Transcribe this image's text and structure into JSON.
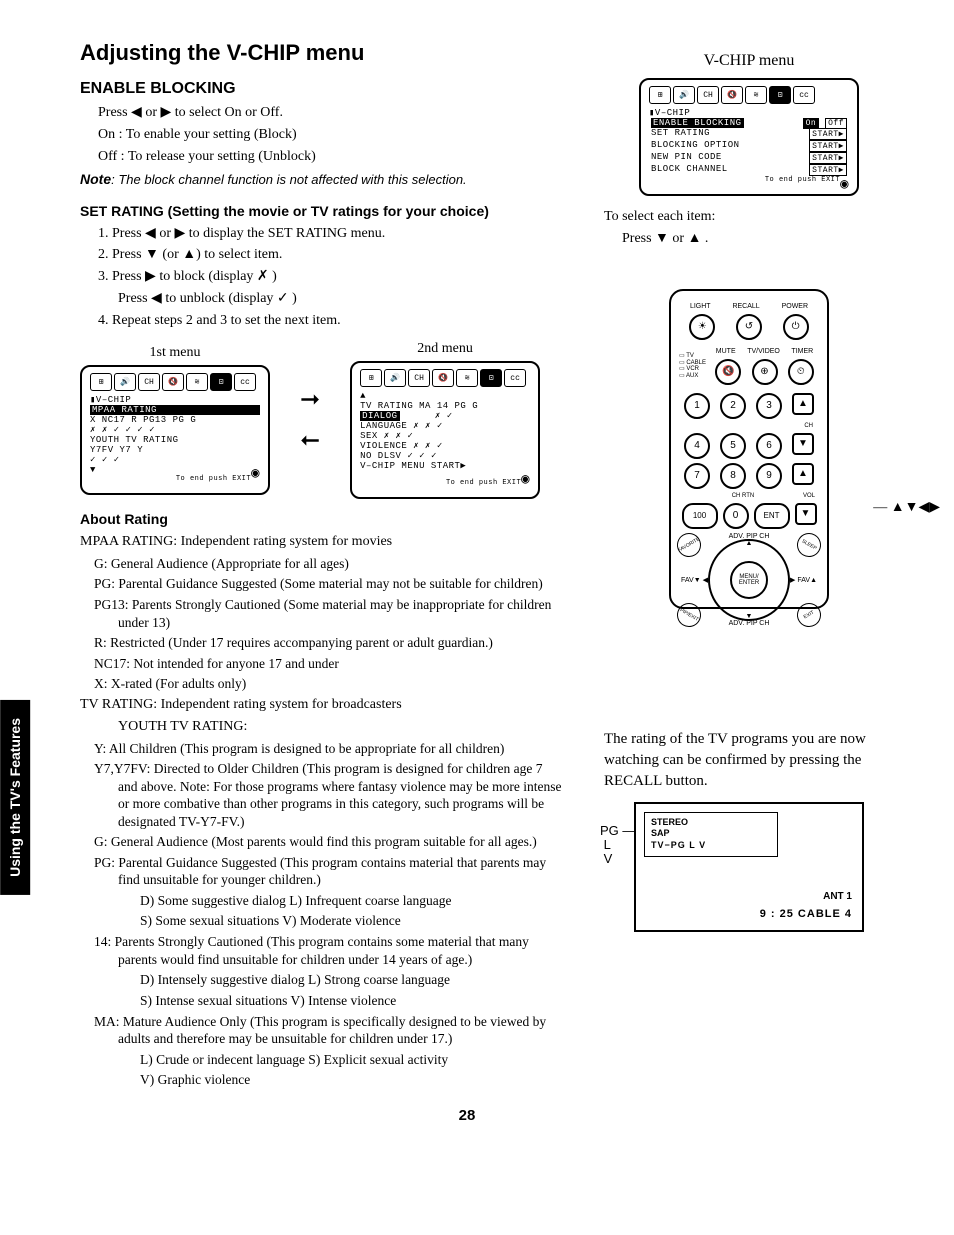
{
  "sideTab": "Using the TV's Features",
  "mainTitle": "Adjusting the V-CHIP menu",
  "enableBlocking": {
    "heading": "ENABLE BLOCKING",
    "line1": "Press ◀ or ▶ to select On or Off.",
    "line2": "On : To enable your setting (Block)",
    "line3": "Off : To release your setting (Unblock)",
    "noteLabel": "Note",
    "noteText": ": The block channel function is not affected with this selection."
  },
  "setRating": {
    "heading": "SET RATING (Setting the movie or TV ratings for your choice)",
    "s1": "Press ◀ or ▶ to display the SET RATING menu.",
    "s2": "Press ▼ (or ▲) to select item.",
    "s3a": "Press ▶ to block (display ✗ )",
    "s3b": "Press ◀ to unblock (display ✓ )",
    "s4": "Repeat steps 2 and 3 to set the next item."
  },
  "menuLabels": {
    "first": "1st menu",
    "second": "2nd menu"
  },
  "osd1": {
    "title": "V–CHIP",
    "r1": "MPAA RATING",
    "r2": "X NC17 R PG13 PG G",
    "r3": "✗  ✗     ✓    ✓    ✓   ✓",
    "r4": "YOUTH TV RATING",
    "r5": "Y7FV Y7  Y",
    "r6": "✓    ✓   ✓",
    "footer": "To end push EXIT"
  },
  "osd2": {
    "r0": "▲",
    "r1": "TV RATING  MA 14 PG G",
    "r2h": "DIALOG",
    "r2v": "✗   ✓",
    "r3": "LANGUAGE     ✗  ✗   ✓",
    "r4": "SEX          ✗  ✗   ✓",
    "r5": "VIOLENCE     ✗  ✗   ✓",
    "r6": "NO DLSV      ✓  ✓   ✓",
    "r7": "V–CHIP MENU   START▶",
    "footer": "To end push EXIT"
  },
  "aboutRating": {
    "heading": "About Rating",
    "mpaa": "MPAA RATING: Independent rating system for movies",
    "g": "G: General Audience (Appropriate for all ages)",
    "pg": "PG: Parental Guidance Suggested (Some material may not be suitable for children)",
    "pg13": "PG13: Parents Strongly Cautioned (Some material may be inappropriate for children under 13)",
    "r": "R: Restricted (Under 17 requires accompanying parent or adult guardian.)",
    "nc17": "NC17: Not intended for anyone 17 and under",
    "x": "X: X-rated (For adults only)",
    "tv": "TV RATING: Independent rating system for broadcasters",
    "youth": "YOUTH TV RATING:",
    "y": "Y: All Children (This program is designed to be appropriate for all children)",
    "y7": "Y7,Y7FV: Directed to Older Children (This program is designed for children age 7 and above. Note: For those programs where fantasy violence may be more intense or more combative than other programs in this category, such programs will be designated TV-Y7-FV.)",
    "tg": "G: General Audience (Most parents would find this program suitable for all ages.)",
    "tpg": "PG: Parental Guidance Suggested (This program contains material that parents may find unsuitable for younger children.)",
    "tpg_d": "D) Some suggestive dialog  L) Infrequent coarse language",
    "tpg_s": "S) Some sexual situations  V) Moderate violence",
    "t14": "14: Parents Strongly Cautioned (This program contains some material that many parents would find unsuitable for children under 14 years of age.)",
    "t14_d": "D) Intensely suggestive dialog  L) Strong coarse language",
    "t14_s": "S) Intense sexual situations  V) Intense violence",
    "tma": "MA: Mature Audience Only (This program is specifically designed to be viewed by adults and therefore may be unsuitable for children under 17.)",
    "tma_l": "L) Crude or indecent language  S) Explicit sexual activity",
    "tma_v": "V) Graphic violence"
  },
  "rightCol": {
    "menuTitle": "V-CHIP menu",
    "osdTitle": "V–CHIP",
    "enable": "ENABLE BLOCKING",
    "on": "On",
    "off": "Off",
    "setRating": "SET RATING",
    "blockOpt": "BLOCKING OPTION",
    "newPin": "NEW PIN CODE",
    "blockCh": "BLOCK CHANNEL",
    "start": "START▶",
    "footer": "To end push EXIT",
    "selectLine": "To select each item:",
    "pressLine": "Press ▼ or ▲ .",
    "arrows": "▲▼◀▶",
    "ratingNote": "The rating of the TV programs you are now watching can be confirmed by pressing the RECALL button."
  },
  "remote": {
    "top": [
      "LIGHT",
      "RECALL",
      "POWER"
    ],
    "row2": [
      "MUTE",
      "TV/VIDEO",
      "TIMER"
    ],
    "side": [
      "TV",
      "CABLE",
      "VCR",
      "AUX"
    ],
    "num": [
      "1",
      "2",
      "3",
      "4",
      "5",
      "6",
      "7",
      "8",
      "9",
      "100",
      "0",
      "ENT"
    ],
    "chvol": [
      "CH",
      "VOL",
      "CH RTN"
    ],
    "dpad": [
      "FAV▼",
      "FAV▲",
      "MENU/ ENTER",
      "ADV. PIP CH",
      "ADV. PIP CH"
    ],
    "corners": [
      "FAVORITE",
      "SLEEP",
      "PIP/EXIT",
      "EXIT"
    ]
  },
  "tvScreen": {
    "pg": "PG",
    "l": "L",
    "v": "V",
    "stereo": "STEREO",
    "sap": "SAP",
    "tvpg": "TV−PG     L        V",
    "ant": "ANT  1",
    "bottom": "9 : 25  CABLE      4"
  },
  "pageNum": "28"
}
